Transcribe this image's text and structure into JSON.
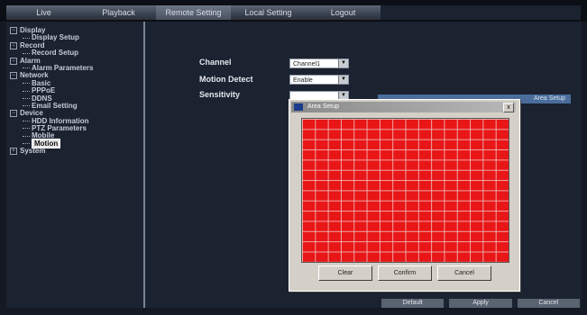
{
  "topbar": {
    "tabs": [
      {
        "label": "Live"
      },
      {
        "label": "Playback"
      },
      {
        "label": "Remote Setting"
      },
      {
        "label": "Local Setting"
      },
      {
        "label": "Logout"
      }
    ]
  },
  "sidebar": {
    "tree": [
      {
        "label": "Display",
        "level": 0,
        "expander": "−"
      },
      {
        "label": "Display Setup",
        "level": 1
      },
      {
        "label": "Record",
        "level": 0,
        "expander": "−"
      },
      {
        "label": "Record Setup",
        "level": 1
      },
      {
        "label": "Alarm",
        "level": 0,
        "expander": "−"
      },
      {
        "label": "Alarm Parameters",
        "level": 1
      },
      {
        "label": "Network",
        "level": 0,
        "expander": "−"
      },
      {
        "label": "Basic",
        "level": 1
      },
      {
        "label": "PPPoE",
        "level": 1
      },
      {
        "label": "DDNS",
        "level": 1
      },
      {
        "label": "Email Setting",
        "level": 1
      },
      {
        "label": "Device",
        "level": 0,
        "expander": "−"
      },
      {
        "label": "HDD Information",
        "level": 1
      },
      {
        "label": "PTZ Parameters",
        "level": 1
      },
      {
        "label": "Mobile",
        "level": 1
      },
      {
        "label": "Motion",
        "level": 1,
        "selected": true
      },
      {
        "label": "System",
        "level": 0,
        "expander": "+"
      }
    ]
  },
  "main": {
    "channel_label": "Channel",
    "channel_value": "Channel1",
    "motion_label": "Motion Detect",
    "motion_value": "Enable",
    "sensitivity_label": "Sensitivity",
    "sensitivity_value": "",
    "area_button_label": "Area Setup",
    "footer_buttons": [
      "Default",
      "Apply",
      "Cancel"
    ]
  },
  "dialog": {
    "title": "Area Setup",
    "close_label": "x",
    "grid": {
      "rows": 14,
      "cols": 16,
      "color": "#e81616"
    },
    "buttons": [
      "Clear",
      "Confirm",
      "Cancel"
    ]
  },
  "colors": {
    "background": "#141923",
    "panel": "#1b2230",
    "accent_blue": "#4a6d9c",
    "grid_red": "#e81616"
  }
}
